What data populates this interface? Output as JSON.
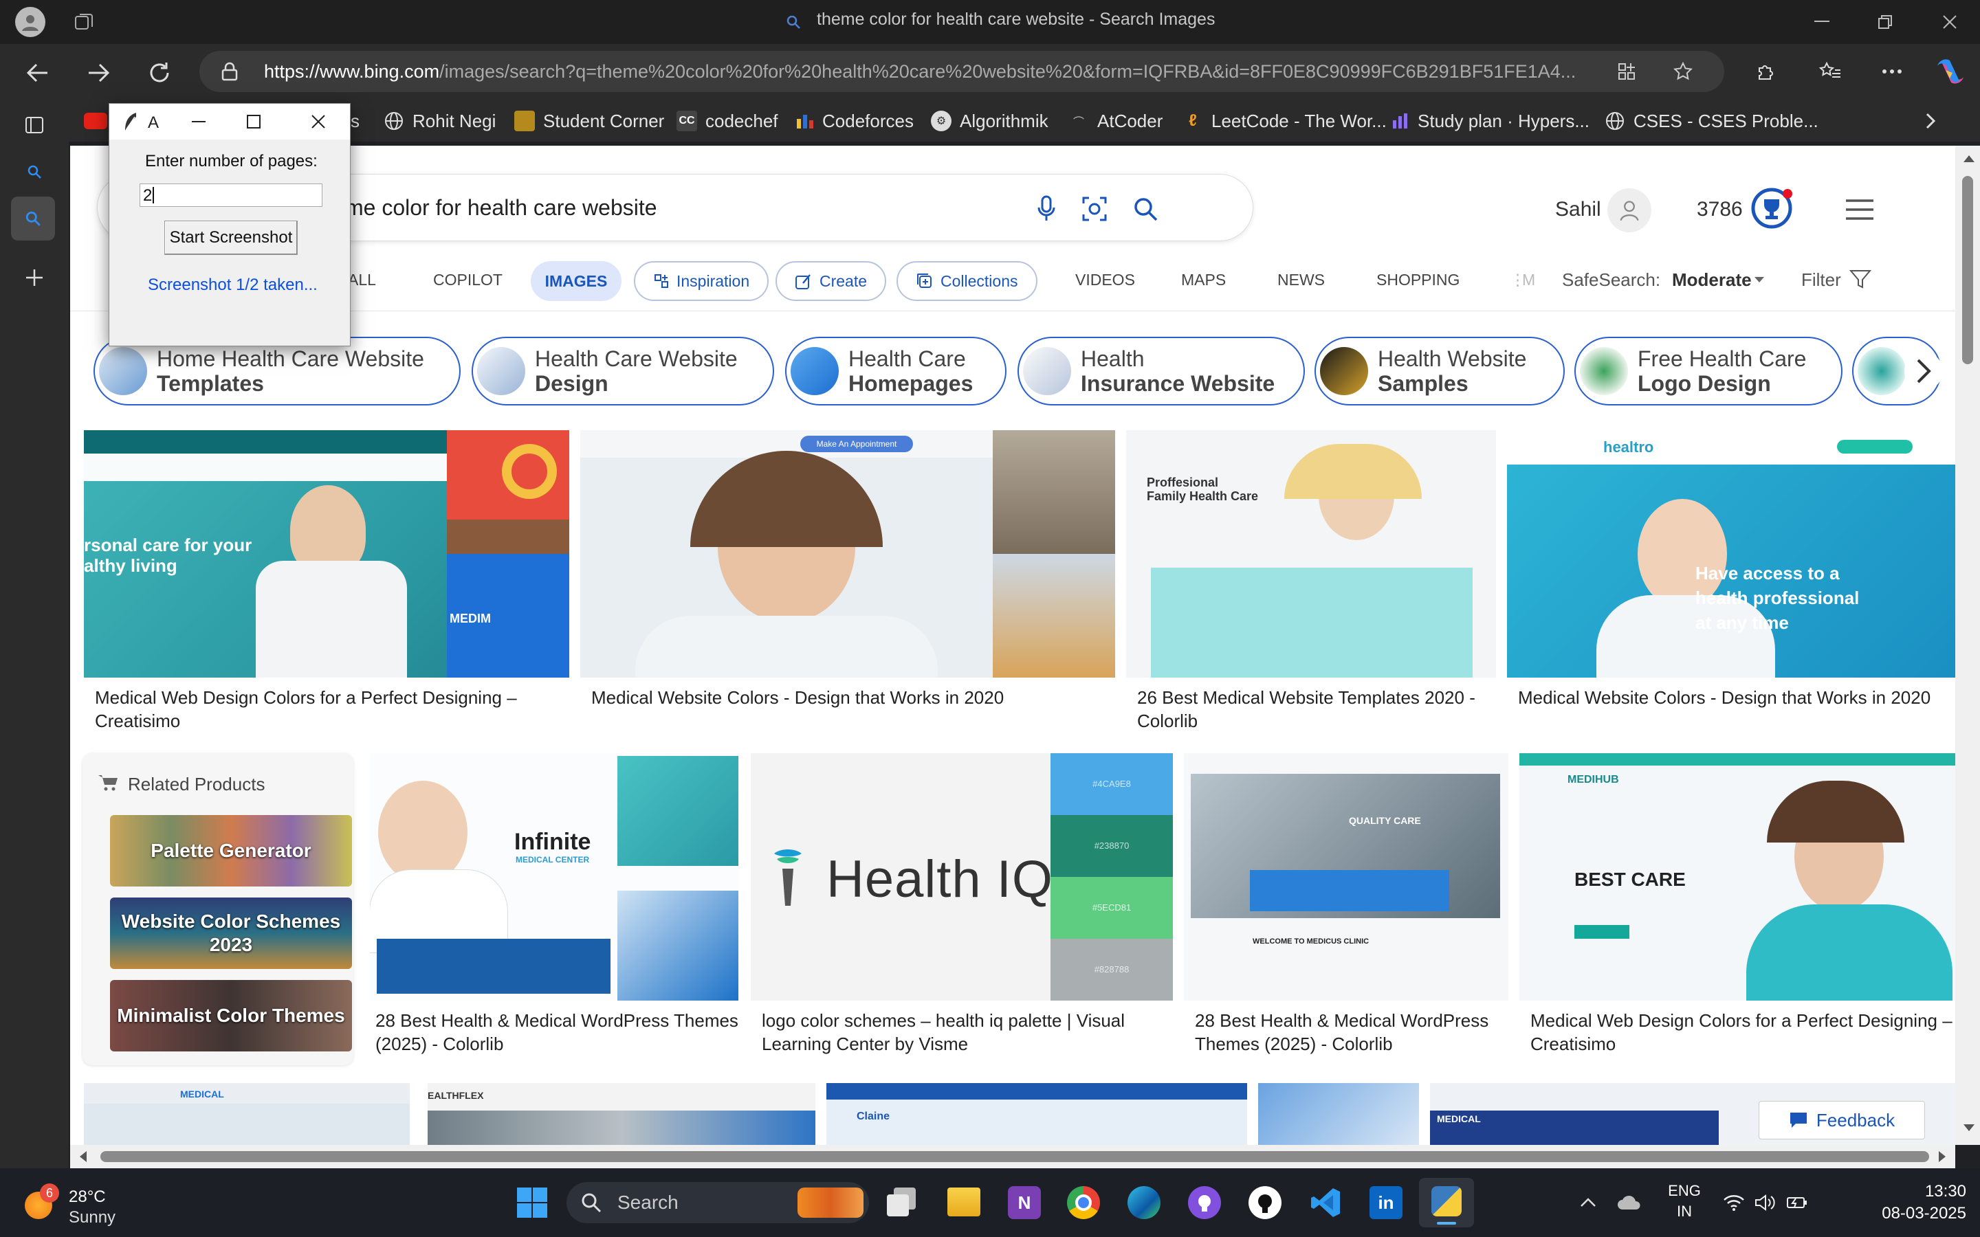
{
  "window": {
    "title": "theme color for health care website - Search Images"
  },
  "browser": {
    "url_host": "https://www.bing.com",
    "url_rest": "/images/search?q=theme%20color%20for%20health%20care%20website%20&form=IQFRBA&id=8FF0E8C90999FC6B291BF51FE1A4...",
    "favorites": [
      "s",
      "Rohit Negi",
      "Student Corner",
      "codechef",
      "Codeforces",
      "Algorithmik",
      "AtCoder",
      "LeetCode - The Wor...",
      "Study plan · Hypers...",
      "CSES - CSES Proble..."
    ]
  },
  "dialog": {
    "title_letter": "A",
    "prompt": "Enter number of pages:",
    "input_value": "2",
    "start_button": "Start Screenshot",
    "status": "Screenshot 1/2 taken..."
  },
  "bing": {
    "query": "me color for health care website",
    "user": "Sahil",
    "points": "3786",
    "tabs": [
      "ALL",
      "COPILOT",
      "IMAGES",
      "VIDEOS",
      "MAPS",
      "NEWS",
      "SHOPPING"
    ],
    "pills": [
      "Inspiration",
      "Create",
      "Collections"
    ],
    "more_fragment": "M",
    "safesearch_label": "SafeSearch:",
    "safesearch_value": "Moderate",
    "filter_label": "Filter",
    "chips": [
      {
        "l1": "Home Health Care Website",
        "l2": "Templates"
      },
      {
        "l1": "Health Care Website",
        "l2": "Design"
      },
      {
        "l1": "Health Care",
        "l2": "Homepages"
      },
      {
        "l1": "Health",
        "l2": "Insurance Website"
      },
      {
        "l1": "Health Website",
        "l2": "Samples"
      },
      {
        "l1": "Free Health Care",
        "l2": "Logo Design"
      }
    ],
    "row1_captions": [
      "Medical Web Design Colors for a Perfect Designing – Creatisimo",
      "Medical Website Colors - Design that Works in 2020",
      "26 Best Medical Website Templates 2020 - Colorlib",
      "Medical Website Colors - Design that Works in 2020"
    ],
    "related": {
      "title": "Related Products",
      "items": [
        "Palette Generator",
        "Website Color Schemes 2023",
        "Minimalist Color Themes"
      ]
    },
    "row2_captions": [
      "28 Best Health & Medical WordPress Themes (2025) - Colorlib",
      "logo color schemes – health iq palette | Visual Learning Center by Visme",
      "28 Best Health & Medical WordPress Themes (2025) - Colorlib",
      "Medical Web Design Colors for a Perfect Designing – Creatisimo"
    ],
    "image_texts": {
      "creatisimo": "rsonal care for your\nalthy living",
      "healtro_brand": "healtro",
      "healtro_slogan": "Have access to a\nhealth professional\nat any time",
      "proffesional": "Proffesional\nFamily Health Care",
      "appointment": "Make An Appointment",
      "infinite": "Infinite",
      "infinite_sub": "MEDICAL CENTER",
      "healthiq": "Health IQ",
      "swatches": [
        "#4CA9E8",
        "#238870",
        "#5ECD81",
        "#828788"
      ],
      "quality": "QUALITY CARE",
      "welcome": "WELCOME TO MEDICUS CLINIC",
      "bestcare": "BEST CARE",
      "medihub": "MEDIHUB",
      "medim": "MEDIM",
      "healthflex": "HEALTHFLEX",
      "medical": "MEDICAL",
      "claine": "Claine",
      "ealthflex": "EALTHFLEX"
    },
    "feedback": "Feedback"
  },
  "taskbar": {
    "weather_badge": "6",
    "temp": "28°C",
    "condition": "Sunny",
    "search": "Search",
    "lang1": "ENG",
    "lang2": "IN",
    "time": "13:30",
    "date": "08-03-2025"
  },
  "colors": {
    "accent": "#2a5fd0",
    "bing_blue": "#1a56b9",
    "dialog_link": "#0b4ee0"
  }
}
